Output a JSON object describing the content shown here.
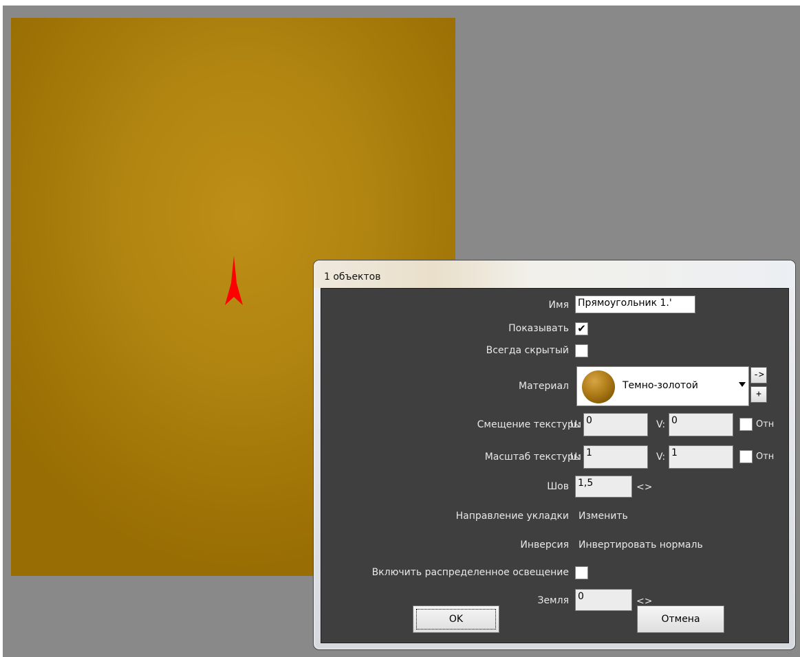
{
  "dialog": {
    "title": "1 объектов",
    "fields": {
      "name_label": "Имя",
      "name_value": "Прямоугольник 1.'",
      "show_label": "Показывать",
      "show_checked": "✔",
      "always_hidden_label": "Всегда скрытый",
      "material_label": "Материал",
      "material_value": "Темно-золотой",
      "material_goto": "->",
      "material_add": "+",
      "tex_offset_label": "Смещение текстуры",
      "u_label": "U:",
      "v_label": "V:",
      "offset_u": "0",
      "offset_v": "0",
      "rel_label": "Отн",
      "tex_scale_label": "Масштаб текстуры",
      "scale_u": "1",
      "scale_v": "1",
      "seam_label": "Шов",
      "seam_value": "1,5",
      "spinner": "<>",
      "direction_label": "Направление укладки",
      "direction_action": "Изменить",
      "inversion_label": "Инверсия",
      "inversion_action": "Инвертировать нормаль",
      "distributed_light_label": "Включить распределенное освещение",
      "ground_label": "Земля",
      "ground_value": "0"
    },
    "buttons": {
      "ok": "OK",
      "cancel": "Отмена"
    }
  },
  "colors": {
    "viewport_bg": "#898989",
    "plane": "#b08410",
    "arrow": "#ff0000",
    "panel": "#3f3f3f"
  },
  "icons": {
    "direction_marker": "arrow-icon",
    "material_preview": "sphere-icon"
  }
}
